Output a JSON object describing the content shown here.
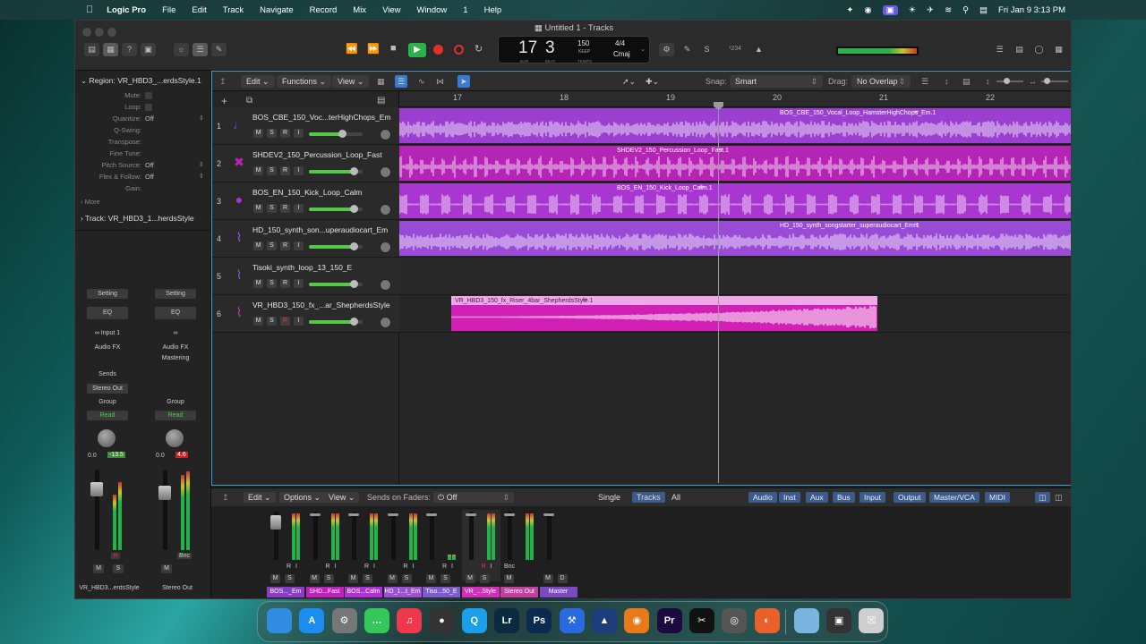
{
  "menubar": {
    "app": "Logic Pro",
    "items": [
      "File",
      "Edit",
      "Track",
      "Navigate",
      "Record",
      "Mix",
      "View",
      "Window",
      "1",
      "Help"
    ],
    "datetime": "Fri Jan 9  3:13 PM"
  },
  "window": {
    "title": "Untitled 1 - Tracks"
  },
  "lcd": {
    "bar": "17",
    "beat": "3",
    "bar_label": "BAR",
    "beat_label": "BEAT",
    "tempo": "150",
    "tempo_mode": "KEEP",
    "tempo_label": "TEMPO",
    "signature": "4/4",
    "key": "Cmaj"
  },
  "count_in": "¹234",
  "inspector": {
    "region_label": "Region:",
    "region_name": "VR_HBD3_...erdsStyle.1",
    "rows": [
      {
        "k": "Mute:",
        "v": ""
      },
      {
        "k": "Loop:",
        "v": ""
      },
      {
        "k": "Quantize:",
        "v": "Off"
      },
      {
        "k": "Q-Swing:",
        "v": ""
      },
      {
        "k": "Transpose:",
        "v": ""
      },
      {
        "k": "Fine Tune:",
        "v": ""
      },
      {
        "k": "Pitch Source:",
        "v": "Off"
      },
      {
        "k": "Flex & Follow:",
        "v": "Off"
      },
      {
        "k": "Gain:",
        "v": ""
      }
    ],
    "more": "More",
    "track_label": "Track:",
    "track_name": "VR_HBD3_1...herdsStyle",
    "strips": [
      {
        "setting": "Setting",
        "eq": "EQ",
        "input": "Input 1",
        "fx": "Audio FX",
        "fx2": "",
        "sends": "Sends",
        "out": "Stereo Out",
        "group": "Group",
        "auto": "Read",
        "pan": "0.0",
        "peak": "-13.5",
        "peak_color": "#3a8a3a",
        "name": "VR_HBD3...erdsStyle",
        "buttons": [
          "M",
          "S"
        ],
        "extra": "R"
      },
      {
        "setting": "Setting",
        "eq": "EQ",
        "input": "",
        "fx": "Audio FX",
        "fx2": "Mastering",
        "sends": "",
        "out": "",
        "group": "Group",
        "auto": "Read",
        "pan": "0.0",
        "peak": "4.6",
        "peak_color": "#c22",
        "name": "Stereo Out",
        "buttons": [
          "M"
        ],
        "extra": "Bnc"
      }
    ]
  },
  "tracks_toolbar": {
    "edit": "Edit",
    "functions": "Functions",
    "view": "View",
    "snap_label": "Snap:",
    "snap_value": "Smart",
    "drag_label": "Drag:",
    "drag_value": "No Overlap"
  },
  "ruler": [
    "17",
    "18",
    "19",
    "20",
    "21",
    "22"
  ],
  "tracks": [
    {
      "num": "1",
      "name": "BOS_CBE_150_Voc...terHighChops_Em",
      "color": "#8a3cc8",
      "icon": "microphone-icon",
      "region": "BOS_CBE_150_Vocal_Loop_HamsterHighChops_Em.1",
      "rcolor": "#9a3fd0",
      "volume": 0.63,
      "buttons": [
        "M",
        "S",
        "R",
        "I"
      ]
    },
    {
      "num": "2",
      "name": "SHDEV2_150_Percussion_Loop_Fast",
      "color": "#c020c0",
      "icon": "percussion-icon",
      "region": "SHDEV2_150_Percussion_Loop_Fast.1",
      "rcolor": "#b524b5",
      "volume": 0.85,
      "buttons": [
        "M",
        "S",
        "R",
        "I"
      ]
    },
    {
      "num": "3",
      "name": "BOS_EN_150_Kick_Loop_Calm",
      "color": "#b030d8",
      "icon": "kick-drum-icon",
      "region": "BOS_EN_150_Kick_Loop_Calm.1",
      "rcolor": "#a936d0",
      "volume": 0.85,
      "buttons": [
        "M",
        "S",
        "R",
        "I"
      ]
    },
    {
      "num": "4",
      "name": "HD_150_synth_son...uperaudiocart_Em",
      "color": "#9a50d8",
      "icon": "waveform-icon",
      "region": "HD_150_synth_songstarter_superaudiocart_Em.1",
      "rcolor": "#9a4bd6",
      "volume": 0.85,
      "buttons": [
        "M",
        "S",
        "R",
        "I"
      ]
    },
    {
      "num": "5",
      "name": "Tisoki_synth_loop_13_150_E",
      "color": "#7c5ad0",
      "icon": "waveform-icon",
      "region": "",
      "rcolor": "",
      "volume": 0.85,
      "buttons": [
        "M",
        "S",
        "R",
        "I"
      ]
    },
    {
      "num": "6",
      "name": "VR_HBD3_150_fx_...ar_ShepherdsStyle",
      "color": "#d030b8",
      "icon": "waveform-icon",
      "region": "VR_HBD3_150_fx_Riser_4bar_ShepherdsStyle.1",
      "rcolor": "#f0a8e8",
      "volume": 0.85,
      "buttons": [
        "M",
        "S",
        "R",
        "I"
      ]
    }
  ],
  "mixer_toolbar": {
    "edit": "Edit",
    "options": "Options",
    "view": "View",
    "sends_label": "Sends on Faders:",
    "sends_value": "Off",
    "modes": [
      "Single",
      "Tracks",
      "All"
    ],
    "active_mode": "Tracks",
    "filters": [
      "Audio",
      "Inst",
      "Aux",
      "Bus",
      "Input",
      "Output",
      "Master/VCA",
      "MIDI"
    ]
  },
  "mixer_channels": [
    {
      "name": "BOS..._Em",
      "color": "#8a3cc8",
      "buttons": [
        "M",
        "S"
      ],
      "extra": [
        "R",
        "I"
      ]
    },
    {
      "name": "SHD...Fast",
      "color": "#c020c0",
      "buttons": [
        "M",
        "S"
      ],
      "extra": [
        "R",
        "I"
      ]
    },
    {
      "name": "BOS...Calm",
      "color": "#b030d8",
      "buttons": [
        "M",
        "S"
      ],
      "extra": [
        "R",
        "I"
      ]
    },
    {
      "name": "HD_1...t_Em",
      "color": "#9a50d8",
      "buttons": [
        "M",
        "S"
      ],
      "extra": [
        "R",
        "I"
      ]
    },
    {
      "name": "Tiso...50_E",
      "color": "#7c5ad0",
      "buttons": [
        "M",
        "S"
      ],
      "extra": [
        "R",
        "I"
      ]
    },
    {
      "name": "VR_...Style",
      "color": "#d030b8",
      "buttons": [
        "M",
        "S"
      ],
      "extra": [
        "R",
        "I"
      ]
    },
    {
      "name": "Stereo Out",
      "color": "#c23fa0",
      "buttons": [
        "M"
      ],
      "extra": [
        "Bnc"
      ]
    },
    {
      "name": "Master",
      "color": "#7a4ac0",
      "buttons": [
        "M",
        "D"
      ],
      "extra": []
    }
  ],
  "dock": [
    {
      "name": "finder-icon",
      "label": "",
      "color": "#2f8ce0"
    },
    {
      "name": "app-store-icon",
      "label": "A",
      "color": "#1c8cf0"
    },
    {
      "name": "system-settings-icon",
      "label": "⚙",
      "color": "#777"
    },
    {
      "name": "messages-icon",
      "label": "…",
      "color": "#34c759"
    },
    {
      "name": "music-icon",
      "label": "♫",
      "color": "#f0384c"
    },
    {
      "name": "obs-icon",
      "label": "●",
      "color": "#333"
    },
    {
      "name": "quicktime-icon",
      "label": "Q",
      "color": "#1aa0e8"
    },
    {
      "name": "lightroom-icon",
      "label": "Lr",
      "color": "#0a2a40"
    },
    {
      "name": "photoshop-icon",
      "label": "Ps",
      "color": "#0a2a50"
    },
    {
      "name": "xcode-tools-icon",
      "label": "⚒",
      "color": "#2a6ae0"
    },
    {
      "name": "affinity-icon",
      "label": "▲",
      "color": "#1c3c7c"
    },
    {
      "name": "blender-icon",
      "label": "◉",
      "color": "#e87a1a"
    },
    {
      "name": "premiere-icon",
      "label": "Pr",
      "color": "#1a0a40"
    },
    {
      "name": "capcut-icon",
      "label": "✂",
      "color": "#111"
    },
    {
      "name": "logic-pro-icon",
      "label": "◎",
      "color": "#555"
    },
    {
      "name": "firefox-icon",
      "label": "◐",
      "color": "#e8602a"
    },
    {
      "name": "folder-icon",
      "label": "",
      "color": "#7ab4e0"
    },
    {
      "name": "screenshot-icon",
      "label": "▣",
      "color": "#333"
    },
    {
      "name": "trash-icon",
      "label": "☒",
      "color": "#cfcfcf"
    }
  ]
}
